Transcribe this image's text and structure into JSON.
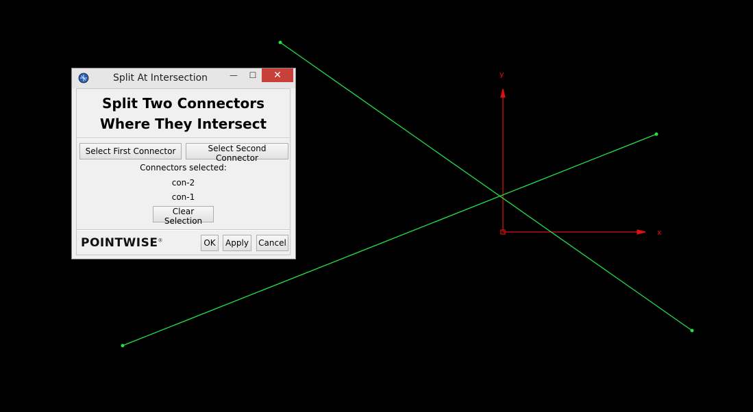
{
  "window": {
    "title": "Split At Intersection",
    "minimize_glyph": "—",
    "maximize_glyph": "☐",
    "close_glyph": "✕",
    "icon": "pointwise-app-icon"
  },
  "panel": {
    "heading_line1": "Split Two Connectors",
    "heading_line2": "Where They Intersect",
    "select_first_label": "Select First Connector",
    "select_second_label": "Select Second Connector",
    "selected_caption": "Connectors selected:",
    "selected_items": [
      "con-2",
      "con-1"
    ],
    "clear_label": "Clear Selection"
  },
  "footer": {
    "logo_text": "POINTWISE",
    "logo_mark": "®",
    "ok_label": "OK",
    "apply_label": "Apply",
    "cancel_label": "Cancel"
  },
  "scene": {
    "axis_x_label": "x",
    "axis_y_label": "y",
    "connector_color": "#22e04a",
    "axis_color": "#e01010",
    "background": "#000000"
  }
}
